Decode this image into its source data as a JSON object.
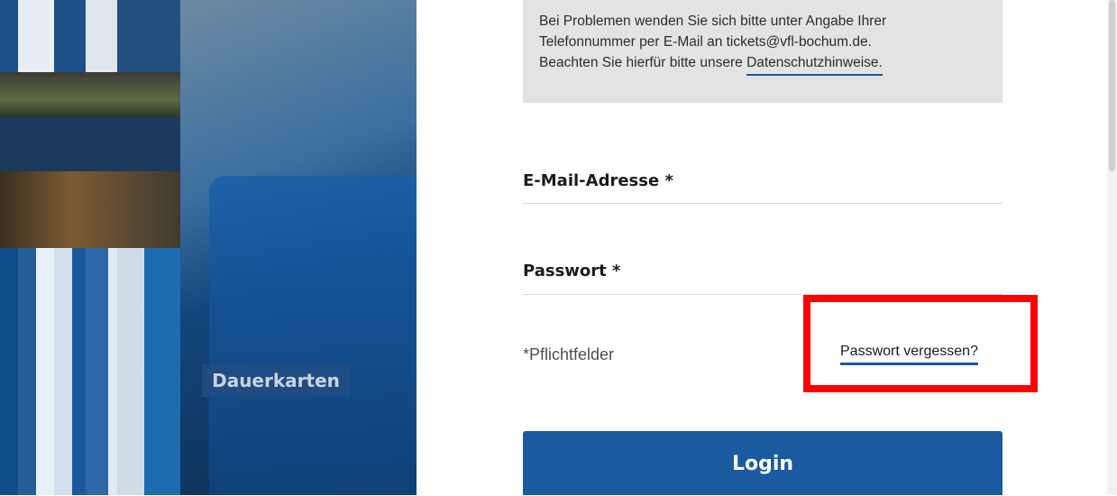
{
  "photo": {
    "category_label": "Dauerkarten"
  },
  "info": {
    "line1": "Bei Problemen wenden Sie sich bitte unter Angabe Ihrer",
    "line2": "Telefonnummer per E-Mail an tickets@vfl-bochum.de.",
    "line3_prefix": "Beachten Sie hierfür bitte unsere ",
    "privacy_link": "Datenschutzhinweise."
  },
  "form": {
    "email_label": "E-Mail-Adresse *",
    "password_label": "Passwort *",
    "required_note": "*Pflichtfelder",
    "forgot_link": "Passwort vergessen?",
    "login_button": "Login"
  },
  "colors": {
    "accent": "#1a5aa0",
    "highlight": "#ff0000"
  }
}
